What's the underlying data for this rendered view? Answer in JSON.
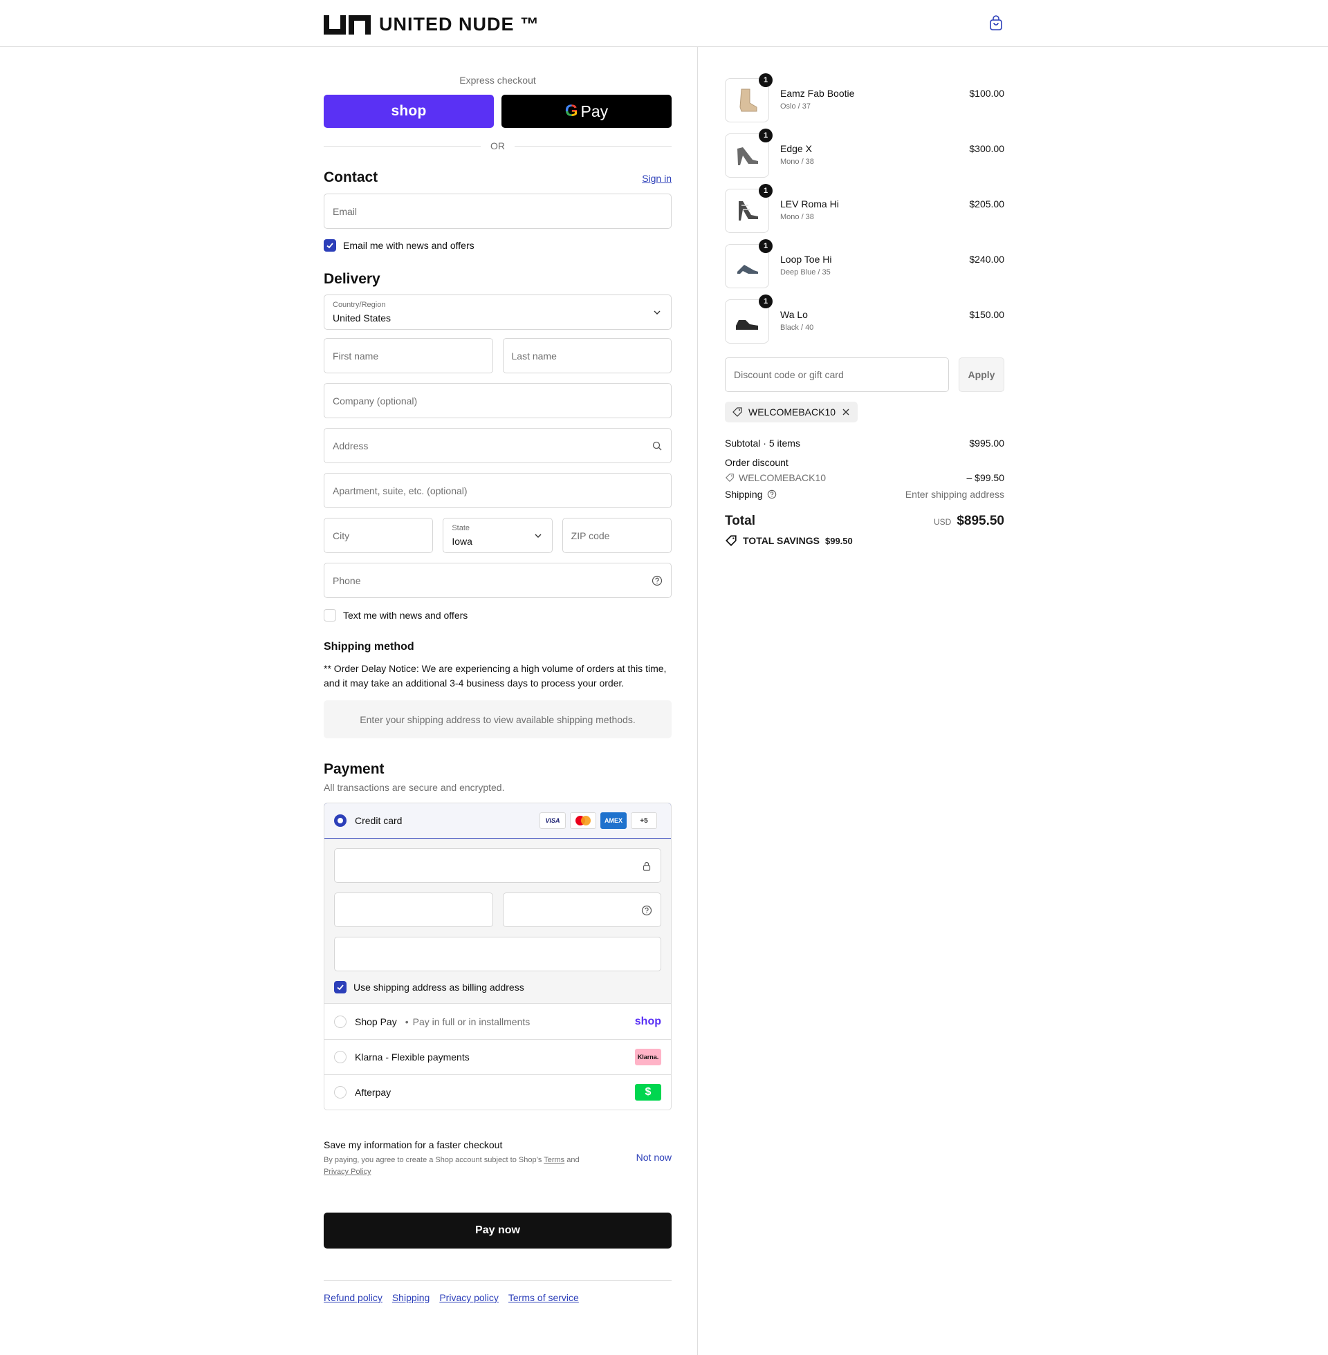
{
  "header": {
    "brand": "UNITED NUDE ™",
    "cart_icon": "shopping-bag-icon"
  },
  "express": {
    "label": "Express checkout",
    "shop_pay": "shop",
    "gpay": "Pay",
    "or": "OR"
  },
  "contact": {
    "title": "Contact",
    "sign_in": "Sign in",
    "email_placeholder": "Email",
    "news_label": "Email me with news and offers",
    "news_checked": true
  },
  "delivery": {
    "title": "Delivery",
    "country_label": "Country/Region",
    "country_value": "United States",
    "first_name": "First name",
    "last_name": "Last name",
    "company": "Company (optional)",
    "address": "Address",
    "apartment": "Apartment, suite, etc. (optional)",
    "city": "City",
    "state_label": "State",
    "state_value": "Iowa",
    "zip": "ZIP code",
    "phone": "Phone",
    "text_label": "Text me with news and offers",
    "text_checked": false
  },
  "shipping_method": {
    "title": "Shipping method",
    "notice": "** Order Delay Notice: We are experiencing a high volume of orders at this time, and it may take an additional 3-4 business days to process your order.",
    "placeholder": "Enter your shipping address to view available shipping methods."
  },
  "payment": {
    "title": "Payment",
    "subtitle": "All transactions are secure and encrypted.",
    "credit_card": "Credit card",
    "badges": {
      "visa": "VISA",
      "amex": "AMEX",
      "more": "+5"
    },
    "billing_label": "Use shipping address as billing address",
    "shop_pay": "Shop Pay",
    "shop_pay_sep": "•",
    "shop_pay_sub": "Pay in full or in installments",
    "shop_logo": "shop",
    "klarna": "Klarna - Flexible payments",
    "klarna_logo": "Klarna.",
    "afterpay": "Afterpay",
    "afterpay_logo": "$"
  },
  "save_info": {
    "title": "Save my information for a faster checkout",
    "fine_prefix": "By paying, you agree to create a Shop account subject to Shop’s",
    "terms": "Terms",
    "and": "and",
    "privacy": "Privacy Policy",
    "not_now": "Not now"
  },
  "pay_now": "Pay now",
  "footer": [
    "Refund policy",
    "Shipping",
    "Privacy policy",
    "Terms of service"
  ],
  "order": {
    "items": [
      {
        "name": "Eamz Fab Bootie",
        "variant": "Oslo / 37",
        "price": "$100.00",
        "qty": "1",
        "color": "#d9bf9c"
      },
      {
        "name": "Edge X",
        "variant": "Mono / 38",
        "price": "$300.00",
        "qty": "1",
        "color": "#6a6a6a"
      },
      {
        "name": "LEV Roma Hi",
        "variant": "Mono / 38",
        "price": "$205.00",
        "qty": "1",
        "color": "#4a4a4a"
      },
      {
        "name": "Loop Toe Hi",
        "variant": "Deep Blue / 35",
        "price": "$240.00",
        "qty": "1",
        "color": "#4d5b6b"
      },
      {
        "name": "Wa Lo",
        "variant": "Black / 40",
        "price": "$150.00",
        "qty": "1",
        "color": "#2a2a2a"
      }
    ],
    "discount_placeholder": "Discount code or gift card",
    "apply": "Apply",
    "code": "WELCOMEBACK10",
    "subtotal_label": "Subtotal · 5 items",
    "subtotal": "$995.00",
    "order_discount_label": "Order discount",
    "discount_code": "WELCOMEBACK10",
    "discount_amount": "– $99.50",
    "shipping_label": "Shipping",
    "shipping_value": "Enter shipping address",
    "total_label": "Total",
    "currency": "USD",
    "total": "$895.50",
    "savings_label": "TOTAL SAVINGS",
    "savings_value": "$99.50"
  },
  "colors": {
    "accent": "#2c3fb9",
    "shop_purple": "#5a31f4",
    "dark": "#111111"
  }
}
